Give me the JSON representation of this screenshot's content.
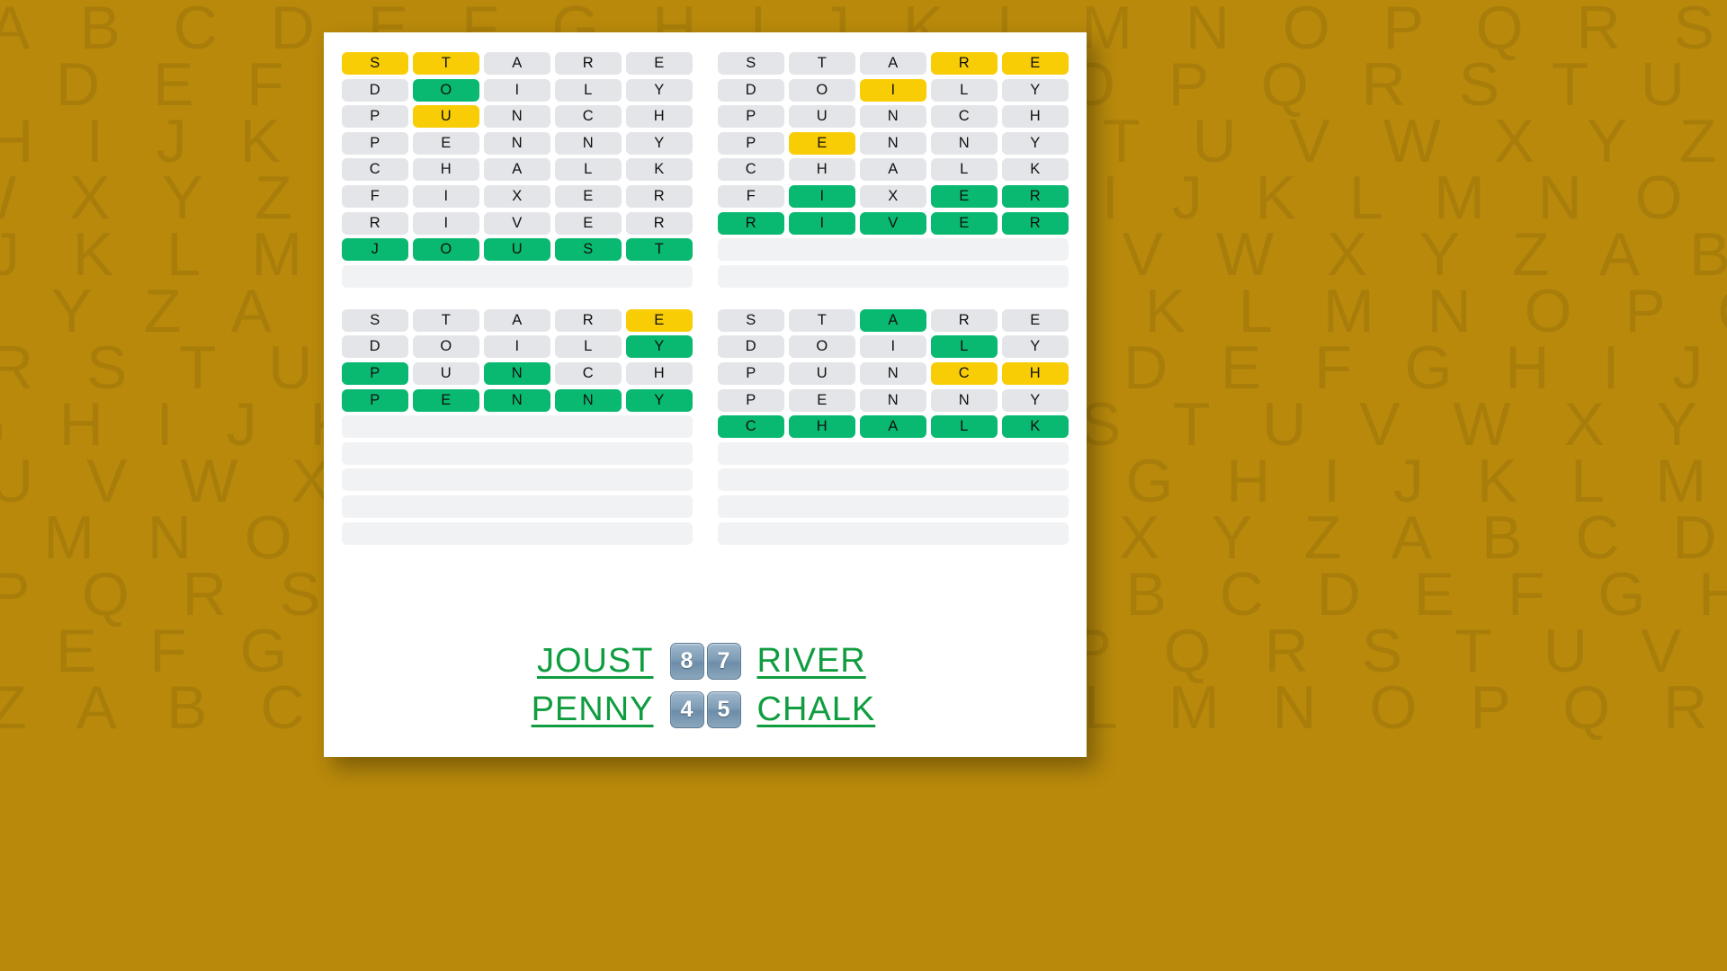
{
  "background": {
    "color": "#b8890b",
    "watermark_alphabet": "ABCDEFGHIJKLMNOPQRSTUVWXYZ",
    "watermark_rows": [
      "ABCDEFGHIJKLMNOPQRSTUVWXYZABCDEF",
      "CDEFGHIJKLMNOPQRSTUVWXYZABCDEFG",
      "HIJKLMNOPQRSTUVWXYZABCDEFGHIJKLM",
      "WXYZABCDEFGHIJKLMNOPQRSTUVWXYZAB",
      "JKLMNOPQRSTUVWXYZABCDEFGHIJKLMNO",
      "XYZABCDEFGHIJKLMNOPQRSTUVWXYZABC",
      "RSTUVWXYZABCDEFGHIJKLMNOPQRSTUVW",
      "GHIJKLMNOPQRSTUVWXYZABCDEFGHIJKL",
      "UVWXYZABCDEFGHIJKLMNOPQRSTUVWXYZ",
      "LMNOPQRSTUVWXYZABCDEFGHIJKLMNOPQ",
      "PQRSTUVWXYZABCDEFGHIJKLMNOPQRSTU",
      "DEFGHIJKLMNOPQRSTUVWXYZABCDEFGHI",
      "ZABCDEFGHIJKLMNOPQRSTUVWXYZABCDE"
    ]
  },
  "colors": {
    "green": "#09b971",
    "yellow": "#f8cd05",
    "gray": "#e3e5e8",
    "blank": "#f1f2f4",
    "card": "#ffffff",
    "word_link": "#0f9d3f",
    "badge": "#7e9cb5"
  },
  "grids": [
    {
      "name": "quadrant-top-left",
      "answer": "JOUST",
      "rows": [
        {
          "letters": [
            "S",
            "T",
            "A",
            "R",
            "E"
          ],
          "states": [
            "yellow",
            "yellow",
            "gray",
            "gray",
            "gray"
          ]
        },
        {
          "letters": [
            "D",
            "O",
            "I",
            "L",
            "Y"
          ],
          "states": [
            "gray",
            "green",
            "gray",
            "gray",
            "gray"
          ]
        },
        {
          "letters": [
            "P",
            "U",
            "N",
            "C",
            "H"
          ],
          "states": [
            "gray",
            "yellow",
            "gray",
            "gray",
            "gray"
          ]
        },
        {
          "letters": [
            "P",
            "E",
            "N",
            "N",
            "Y"
          ],
          "states": [
            "gray",
            "gray",
            "gray",
            "gray",
            "gray"
          ]
        },
        {
          "letters": [
            "C",
            "H",
            "A",
            "L",
            "K"
          ],
          "states": [
            "gray",
            "gray",
            "gray",
            "gray",
            "gray"
          ]
        },
        {
          "letters": [
            "F",
            "I",
            "X",
            "E",
            "R"
          ],
          "states": [
            "gray",
            "gray",
            "gray",
            "gray",
            "gray"
          ]
        },
        {
          "letters": [
            "R",
            "I",
            "V",
            "E",
            "R"
          ],
          "states": [
            "gray",
            "gray",
            "gray",
            "gray",
            "gray"
          ]
        },
        {
          "letters": [
            "J",
            "O",
            "U",
            "S",
            "T"
          ],
          "states": [
            "green",
            "green",
            "green",
            "green",
            "green"
          ]
        },
        {
          "letters": [
            "",
            "",
            "",
            "",
            ""
          ],
          "states": [
            "blank",
            "blank",
            "blank",
            "blank",
            "blank"
          ]
        }
      ]
    },
    {
      "name": "quadrant-top-right",
      "answer": "RIVER",
      "rows": [
        {
          "letters": [
            "S",
            "T",
            "A",
            "R",
            "E"
          ],
          "states": [
            "gray",
            "gray",
            "gray",
            "yellow",
            "yellow"
          ]
        },
        {
          "letters": [
            "D",
            "O",
            "I",
            "L",
            "Y"
          ],
          "states": [
            "gray",
            "gray",
            "yellow",
            "gray",
            "gray"
          ]
        },
        {
          "letters": [
            "P",
            "U",
            "N",
            "C",
            "H"
          ],
          "states": [
            "gray",
            "gray",
            "gray",
            "gray",
            "gray"
          ]
        },
        {
          "letters": [
            "P",
            "E",
            "N",
            "N",
            "Y"
          ],
          "states": [
            "gray",
            "yellow",
            "gray",
            "gray",
            "gray"
          ]
        },
        {
          "letters": [
            "C",
            "H",
            "A",
            "L",
            "K"
          ],
          "states": [
            "gray",
            "gray",
            "gray",
            "gray",
            "gray"
          ]
        },
        {
          "letters": [
            "F",
            "I",
            "X",
            "E",
            "R"
          ],
          "states": [
            "gray",
            "green",
            "gray",
            "green",
            "green"
          ]
        },
        {
          "letters": [
            "R",
            "I",
            "V",
            "E",
            "R"
          ],
          "states": [
            "green",
            "green",
            "green",
            "green",
            "green"
          ]
        },
        {
          "letters": [
            "",
            "",
            "",
            "",
            ""
          ],
          "states": [
            "blank",
            "blank",
            "blank",
            "blank",
            "blank"
          ]
        },
        {
          "letters": [
            "",
            "",
            "",
            "",
            ""
          ],
          "states": [
            "blank",
            "blank",
            "blank",
            "blank",
            "blank"
          ]
        }
      ]
    },
    {
      "name": "quadrant-bottom-left",
      "answer": "PENNY",
      "rows": [
        {
          "letters": [
            "S",
            "T",
            "A",
            "R",
            "E"
          ],
          "states": [
            "gray",
            "gray",
            "gray",
            "gray",
            "yellow"
          ]
        },
        {
          "letters": [
            "D",
            "O",
            "I",
            "L",
            "Y"
          ],
          "states": [
            "gray",
            "gray",
            "gray",
            "gray",
            "green"
          ]
        },
        {
          "letters": [
            "P",
            "U",
            "N",
            "C",
            "H"
          ],
          "states": [
            "green",
            "gray",
            "green",
            "gray",
            "gray"
          ]
        },
        {
          "letters": [
            "P",
            "E",
            "N",
            "N",
            "Y"
          ],
          "states": [
            "green",
            "green",
            "green",
            "green",
            "green"
          ]
        },
        {
          "letters": [
            "",
            "",
            "",
            "",
            ""
          ],
          "states": [
            "blank",
            "blank",
            "blank",
            "blank",
            "blank"
          ]
        },
        {
          "letters": [
            "",
            "",
            "",
            "",
            ""
          ],
          "states": [
            "blank",
            "blank",
            "blank",
            "blank",
            "blank"
          ]
        },
        {
          "letters": [
            "",
            "",
            "",
            "",
            ""
          ],
          "states": [
            "blank",
            "blank",
            "blank",
            "blank",
            "blank"
          ]
        },
        {
          "letters": [
            "",
            "",
            "",
            "",
            ""
          ],
          "states": [
            "blank",
            "blank",
            "blank",
            "blank",
            "blank"
          ]
        },
        {
          "letters": [
            "",
            "",
            "",
            "",
            ""
          ],
          "states": [
            "blank",
            "blank",
            "blank",
            "blank",
            "blank"
          ]
        }
      ]
    },
    {
      "name": "quadrant-bottom-right",
      "answer": "CHALK",
      "rows": [
        {
          "letters": [
            "S",
            "T",
            "A",
            "R",
            "E"
          ],
          "states": [
            "gray",
            "gray",
            "green",
            "gray",
            "gray"
          ]
        },
        {
          "letters": [
            "D",
            "O",
            "I",
            "L",
            "Y"
          ],
          "states": [
            "gray",
            "gray",
            "gray",
            "green",
            "gray"
          ]
        },
        {
          "letters": [
            "P",
            "U",
            "N",
            "C",
            "H"
          ],
          "states": [
            "gray",
            "gray",
            "gray",
            "yellow",
            "yellow"
          ]
        },
        {
          "letters": [
            "P",
            "E",
            "N",
            "N",
            "Y"
          ],
          "states": [
            "gray",
            "gray",
            "gray",
            "gray",
            "gray"
          ]
        },
        {
          "letters": [
            "C",
            "H",
            "A",
            "L",
            "K"
          ],
          "states": [
            "green",
            "green",
            "green",
            "green",
            "green"
          ]
        },
        {
          "letters": [
            "",
            "",
            "",
            "",
            ""
          ],
          "states": [
            "blank",
            "blank",
            "blank",
            "blank",
            "blank"
          ]
        },
        {
          "letters": [
            "",
            "",
            "",
            "",
            ""
          ],
          "states": [
            "blank",
            "blank",
            "blank",
            "blank",
            "blank"
          ]
        },
        {
          "letters": [
            "",
            "",
            "",
            "",
            ""
          ],
          "states": [
            "blank",
            "blank",
            "blank",
            "blank",
            "blank"
          ]
        },
        {
          "letters": [
            "",
            "",
            "",
            "",
            ""
          ],
          "states": [
            "blank",
            "blank",
            "blank",
            "blank",
            "blank"
          ]
        }
      ]
    }
  ],
  "footer": {
    "rows": [
      {
        "left_word": "JOUST",
        "left_score": "8",
        "right_score": "7",
        "right_word": "RIVER"
      },
      {
        "left_word": "PENNY",
        "left_score": "4",
        "right_score": "5",
        "right_word": "CHALK"
      }
    ]
  }
}
